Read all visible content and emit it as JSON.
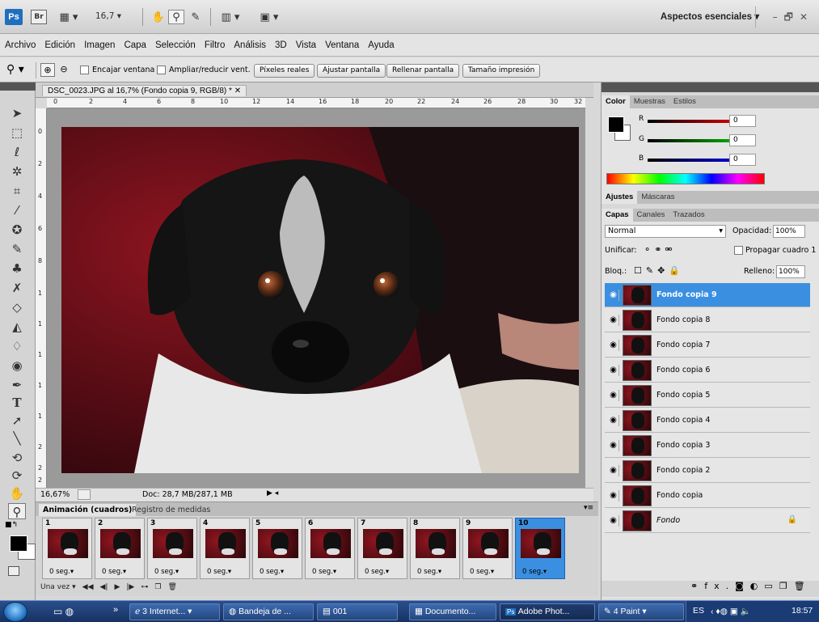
{
  "appbar": {
    "logo": "Ps",
    "bridge": "Br",
    "zoom": "16,7",
    "workspace": "Aspectos esenciales"
  },
  "menu": [
    "Archivo",
    "Edición",
    "Imagen",
    "Capa",
    "Selección",
    "Filtro",
    "Análisis",
    "3D",
    "Vista",
    "Ventana",
    "Ayuda"
  ],
  "options": {
    "fit_window": "Encajar ventana",
    "resize": "Ampliar/reducir vent.",
    "actual_pixels": "Píxeles reales",
    "fit_screen": "Ajustar pantalla",
    "fill_screen": "Rellenar pantalla",
    "print_size": "Tamaño impresión"
  },
  "document": {
    "title": "DSC_0023.JPG al 16,7% (Fondo copia 9, RGB/8) *",
    "ruler_top": [
      "0",
      "2",
      "4",
      "6",
      "8",
      "10",
      "12",
      "14",
      "16",
      "18",
      "20",
      "22",
      "24",
      "26",
      "28",
      "30",
      "32"
    ],
    "ruler_left": [
      "0",
      "2",
      "4",
      "6",
      "8",
      "1",
      "1",
      "1",
      "1",
      "1",
      "2",
      "2",
      "2"
    ],
    "zoom": "16,67%",
    "doc_size": "Doc: 28,7 MB/287,1 MB"
  },
  "animation": {
    "tab_active": "Animación (cuadros)",
    "tab_other": "Registro de medidas",
    "frames": [
      {
        "num": "1",
        "delay": "0 seg."
      },
      {
        "num": "2",
        "delay": "0 seg."
      },
      {
        "num": "3",
        "delay": "0 seg."
      },
      {
        "num": "4",
        "delay": "0 seg."
      },
      {
        "num": "5",
        "delay": "0 seg."
      },
      {
        "num": "6",
        "delay": "0 seg."
      },
      {
        "num": "7",
        "delay": "0 seg."
      },
      {
        "num": "8",
        "delay": "0 seg."
      },
      {
        "num": "9",
        "delay": "0 seg."
      },
      {
        "num": "10",
        "delay": "0 seg."
      }
    ],
    "loop": "Una vez"
  },
  "color_panel": {
    "tabs": [
      "Color",
      "Muestras",
      "Estilos"
    ],
    "r_label": "R",
    "g_label": "G",
    "b_label": "B",
    "r": "0",
    "g": "0",
    "b": "0"
  },
  "adjust_panel": {
    "tabs": [
      "Ajustes",
      "Máscaras"
    ]
  },
  "layers_panel": {
    "tabs": [
      "Capas",
      "Canales",
      "Trazados"
    ],
    "blend_mode": "Normal",
    "opacity_label": "Opacidad:",
    "opacity": "100%",
    "unify_label": "Unificar:",
    "propagate": "Propagar cuadro 1",
    "lock_label": "Bloq.:",
    "fill_label": "Relleno:",
    "fill": "100%",
    "layers": [
      {
        "name": "Fondo copia 9"
      },
      {
        "name": "Fondo copia 8"
      },
      {
        "name": "Fondo copia 7"
      },
      {
        "name": "Fondo copia 6"
      },
      {
        "name": "Fondo copia 5"
      },
      {
        "name": "Fondo copia 4"
      },
      {
        "name": "Fondo copia 3"
      },
      {
        "name": "Fondo copia 2"
      },
      {
        "name": "Fondo copia"
      },
      {
        "name": "Fondo"
      }
    ],
    "footer_fx": "fx."
  },
  "taskbar": {
    "items": [
      "3 Internet...",
      "Bandeja de ...",
      "001",
      "Documento...",
      "Adobe Phot...",
      "4 Paint"
    ],
    "lang": "ES",
    "time": "18:57"
  },
  "colors": {
    "selection": "#3b8fe0",
    "taskbar": "#1f3f78"
  }
}
